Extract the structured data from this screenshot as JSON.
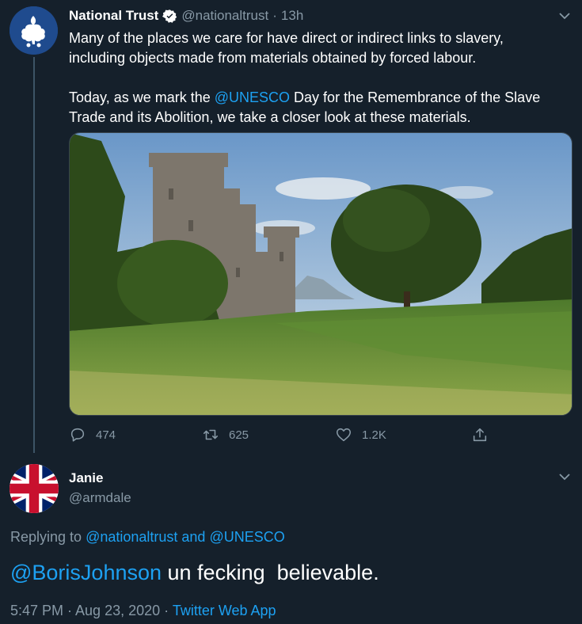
{
  "tweet": {
    "author_name": "National Trust",
    "handle": "@nationaltrust",
    "dot": "·",
    "time": "13h",
    "paragraph1": "Many of the places we care for have direct or indirect links to slavery, including objects made from materials obtained by forced labour.",
    "paragraph2_before": "Today, as we mark the ",
    "paragraph2_mention": "@UNESCO",
    "paragraph2_after": " Day for the Remembrance of the Slave Trade and its Abolition, we take a closer look at these materials.",
    "image_alt": "castle-landscape-photo",
    "actions": {
      "replies": "474",
      "retweets": "625",
      "likes": "1.2K"
    }
  },
  "reply": {
    "author_name": "Janie",
    "handle": "@armdale",
    "replying_prefix": "Replying to ",
    "replying_to_1": "@nationaltrust",
    "replying_and": " and ",
    "replying_to_2": "@UNESCO",
    "text_mention": "@BorisJohnson",
    "text_rest": " un fecking  believable.",
    "timestamp": "5:47 PM · Aug 23, 2020 · ",
    "source": "Twitter Web App"
  },
  "colors": {
    "background": "#15202b",
    "link": "#1da1f2",
    "muted": "#8899a6"
  }
}
